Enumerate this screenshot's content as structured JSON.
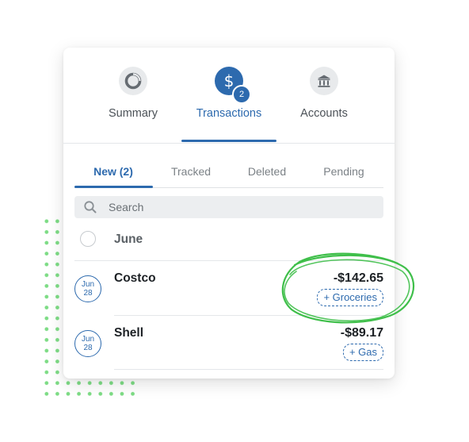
{
  "top_tabs": [
    {
      "label": "Summary",
      "icon": "pie-chart-icon"
    },
    {
      "label": "Transactions",
      "icon": "dollar-icon",
      "glyph": "$",
      "badge": "2"
    },
    {
      "label": "Accounts",
      "icon": "bank-icon"
    }
  ],
  "sub_tabs": [
    {
      "label": "New (2)"
    },
    {
      "label": "Tracked"
    },
    {
      "label": "Deleted"
    },
    {
      "label": "Pending"
    }
  ],
  "search": {
    "placeholder": "Search"
  },
  "group": {
    "label": "June"
  },
  "transactions": [
    {
      "month": "Jun",
      "day": "28",
      "name": "Costco",
      "amount": "-$142.65",
      "category": "+ Groceries"
    },
    {
      "month": "Jun",
      "day": "28",
      "name": "Shell",
      "amount": "-$89.17",
      "category": "+ Gas"
    }
  ],
  "colors": {
    "accent": "#2d6aae",
    "annotation": "#3fbf4a",
    "dots": "#7ddc85"
  }
}
